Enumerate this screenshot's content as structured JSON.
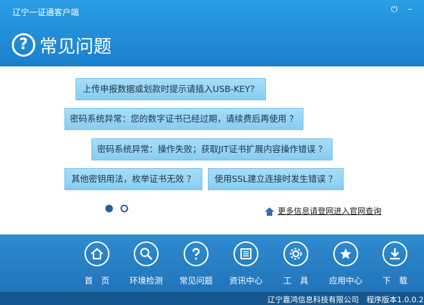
{
  "window": {
    "title": "辽宁一证通客户端",
    "power_glyph": "⏻",
    "minimize_glyph": "–"
  },
  "header": {
    "title": "常见问题",
    "icon_glyph": "?"
  },
  "faq": [
    "上传申报数据或划款时提示请插入USB-KEY？",
    "密码系统异常：您的数字证书已经过期，请续费后再使用 ？",
    "密码系统异常：操作失败；获取JIT证书扩展内容操作错误 ？",
    "其他密钥用法，枚举证书无效 ？",
    "使用SSL建立连接时发生错误 ？"
  ],
  "pagination": {
    "active": 1,
    "total": 2
  },
  "more_link": "更多信息请登网进入官网查询",
  "nav": [
    {
      "label": "首　页",
      "icon": "home-icon"
    },
    {
      "label": "环境检测",
      "icon": "search-icon"
    },
    {
      "label": "常见问题",
      "icon": "question-icon"
    },
    {
      "label": "资讯中心",
      "icon": "news-icon"
    },
    {
      "label": "工　具",
      "icon": "gear-icon"
    },
    {
      "label": "应用中心",
      "icon": "star-icon"
    },
    {
      "label": "下　载",
      "icon": "download-icon"
    }
  ],
  "footer": {
    "text": "辽宁嘉鸿信息科技有限公司　程序版本1.0.0.2"
  },
  "colors": {
    "header_blue": "#1a7fcc",
    "faq_button": "#a8ddf7",
    "nav_blue": "#1f6fb4"
  }
}
